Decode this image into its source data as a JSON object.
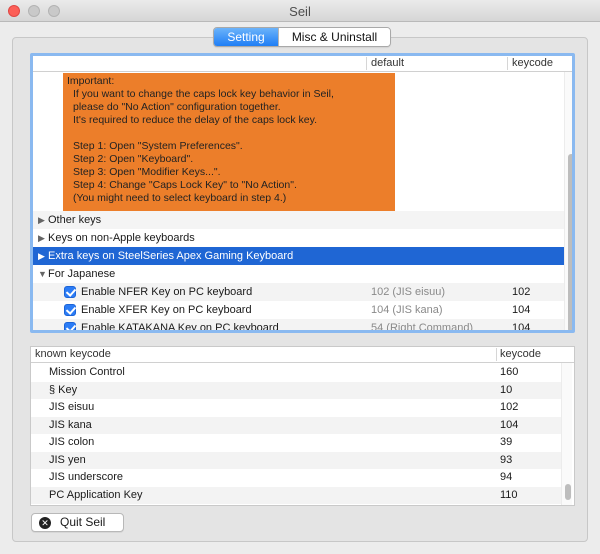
{
  "window": {
    "title": "Seil"
  },
  "tabs": [
    {
      "label": "Setting",
      "active": true
    },
    {
      "label": "Misc & Uninstall",
      "active": false
    }
  ],
  "settings_table": {
    "columns": {
      "default": "default",
      "keycode": "keycode"
    },
    "notice_lines": [
      "Important:",
      "If you want to change the caps lock key behavior in Seil,",
      "please do \"No Action\" configuration together.",
      "It's required to reduce the delay of the caps lock key.",
      "",
      "Step 1: Open \"System Preferences\".",
      "Step 2: Open \"Keyboard\".",
      "Step 3: Open \"Modifier Keys...\".",
      "Step 4: Change \"Caps Lock Key\" to \"No Action\".",
      "(You might need to select keyboard in step 4.)"
    ],
    "groups": [
      {
        "label": "Other keys",
        "expanded": false
      },
      {
        "label": "Keys on non-Apple keyboards",
        "expanded": false
      },
      {
        "label": "Extra keys on SteelSeries Apex Gaming Keyboard",
        "expanded": false
      },
      {
        "label": "For Japanese",
        "expanded": true
      }
    ],
    "japanese_items": [
      {
        "name": "Enable NFER Key on PC keyboard",
        "default": "102 (JIS eisuu)",
        "keycode": "102",
        "checked": true
      },
      {
        "name": "Enable XFER Key on PC keyboard",
        "default": "104 (JIS kana)",
        "keycode": "104",
        "checked": true
      },
      {
        "name": "Enable KATAKANA Key on PC keyboard",
        "default": "54 (Right Command)",
        "keycode": "104",
        "checked": true
      }
    ]
  },
  "known_table": {
    "columns": {
      "name": "known keycode",
      "keycode": "keycode"
    },
    "rows": [
      {
        "name": "Mission Control",
        "keycode": "160"
      },
      {
        "name": "§ Key",
        "keycode": "10"
      },
      {
        "name": "JIS eisuu",
        "keycode": "102"
      },
      {
        "name": "JIS kana",
        "keycode": "104"
      },
      {
        "name": "JIS colon",
        "keycode": "39"
      },
      {
        "name": "JIS yen",
        "keycode": "93"
      },
      {
        "name": "JIS underscore",
        "keycode": "94"
      },
      {
        "name": "PC Application Key",
        "keycode": "110"
      }
    ]
  },
  "quit_button": {
    "label": "Quit Seil",
    "icon": "close-circle-icon"
  },
  "colors": {
    "accent": "#1f66d4",
    "notice_bg": "#ec7e2a",
    "focus_ring": "#8ab9f0"
  }
}
